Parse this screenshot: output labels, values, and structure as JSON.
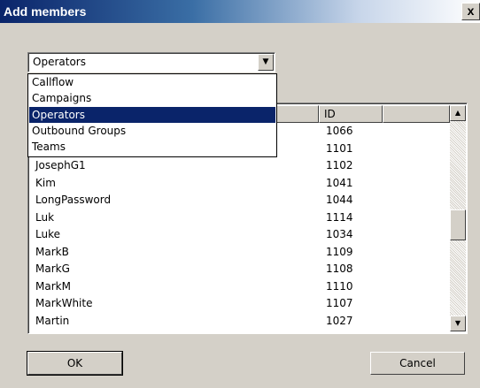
{
  "window": {
    "title": "Add members",
    "close_label": "x"
  },
  "combo": {
    "selected": "Operators",
    "arrow_icon": "chevron-down-icon",
    "options": [
      "Callflow",
      "Campaigns",
      "Operators",
      "Outbound Groups",
      "Teams"
    ],
    "highlighted_index": 2
  },
  "list": {
    "columns": [
      "",
      "ID",
      ""
    ],
    "rows": [
      {
        "name": "",
        "id": "1066"
      },
      {
        "name": "",
        "id": "1101"
      },
      {
        "name": "JosephG1",
        "id": "1102"
      },
      {
        "name": "Kim",
        "id": "1041"
      },
      {
        "name": "LongPassword",
        "id": "1044"
      },
      {
        "name": "Luk",
        "id": "1114"
      },
      {
        "name": "Luke",
        "id": "1034"
      },
      {
        "name": "MarkB",
        "id": "1109"
      },
      {
        "name": "MarkG",
        "id": "1108"
      },
      {
        "name": "MarkM",
        "id": "1110"
      },
      {
        "name": "MarkWhite",
        "id": "1107"
      },
      {
        "name": "Martin",
        "id": "1027"
      }
    ]
  },
  "buttons": {
    "ok": "OK",
    "cancel": "Cancel"
  },
  "colors": {
    "title_bar": "#0a246a",
    "selection": "#0a246a",
    "face": "#d4d0c8"
  }
}
